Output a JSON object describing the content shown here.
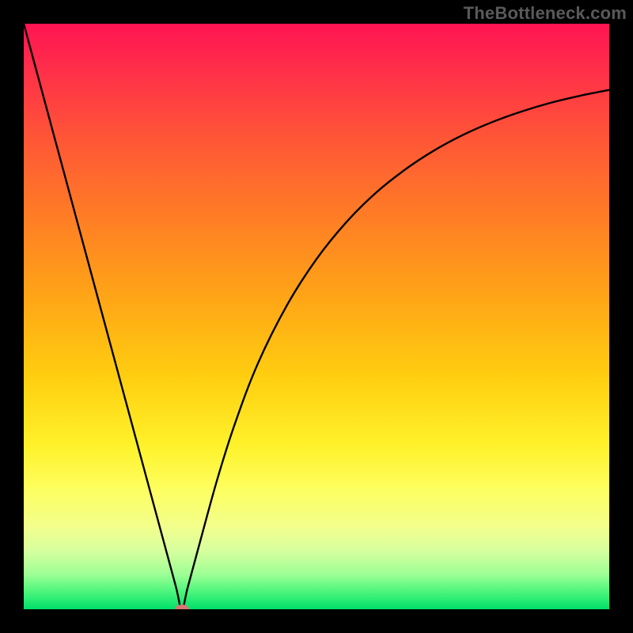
{
  "watermark": "TheBottleneck.com",
  "chart_data": {
    "type": "line",
    "title": "",
    "xlabel": "",
    "ylabel": "",
    "xlim": [
      0,
      100
    ],
    "ylim": [
      0,
      100
    ],
    "grid": false,
    "legend": false,
    "series": [
      {
        "name": "curve",
        "x": [
          0,
          5,
          10,
          15,
          20,
          24,
          26,
          27,
          28,
          30,
          33,
          36,
          40,
          45,
          50,
          55,
          60,
          65,
          70,
          75,
          80,
          85,
          90,
          95,
          100
        ],
        "y": [
          100,
          81.5,
          63,
          44.5,
          26,
          11.2,
          3.8,
          0,
          3.7,
          11.1,
          22,
          31.5,
          42,
          52,
          59.8,
          66,
          71,
          75,
          78.3,
          81,
          83.2,
          85,
          86.5,
          87.7,
          88.7
        ]
      }
    ],
    "marker": {
      "x": 27,
      "y": 0,
      "color": "#d77874"
    },
    "background_gradient": {
      "top": "#ff1452",
      "mid": "#ffd000",
      "bottom": "#00e06a"
    }
  }
}
